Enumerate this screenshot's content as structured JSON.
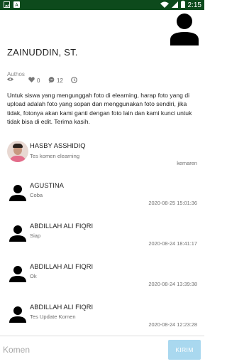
{
  "status_bar": {
    "time": "2:15"
  },
  "author": {
    "name": "ZAINUDDIN, ST.",
    "role": "Authos"
  },
  "stats": {
    "likes": "0",
    "comments": "12"
  },
  "article": {
    "body": "Untuk siswa yang mengunggah foto di elearning, harap foto yang di upload adalah foto yang sopan dan menggunakan foto sendiri, jika tidak, fotonya akan kami ganti dengan foto lain dan kami kunci untuk tidak bisa di edit. Terima kasih."
  },
  "comments": [
    {
      "name": "HASBY ASSHIDIQ",
      "text": "Tes komen elearning",
      "time": "kemaren",
      "avatar": "photo"
    },
    {
      "name": "AGUSTINA",
      "text": "Coba",
      "time": "2020-08-25 15:01:36",
      "avatar": "person-icon"
    },
    {
      "name": "ABDILLAH ALI FIQRI",
      "text": "Siap",
      "time": "2020-08-24 18:41:17",
      "avatar": "person-icon"
    },
    {
      "name": "ABDILLAH ALI FIQRI",
      "text": "Ok",
      "time": "2020-08-24 13:39:38",
      "avatar": "person-icon"
    },
    {
      "name": "ABDILLAH ALI FIQRI",
      "text": "Tes Update Komen",
      "time": "2020-08-24 12:23:28",
      "avatar": "person-icon"
    }
  ],
  "compose": {
    "placeholder": "Komen",
    "send_label": "KIRIM"
  },
  "colors": {
    "status_bar": "#0d4a1c",
    "send_button": "#a9d8ef"
  }
}
